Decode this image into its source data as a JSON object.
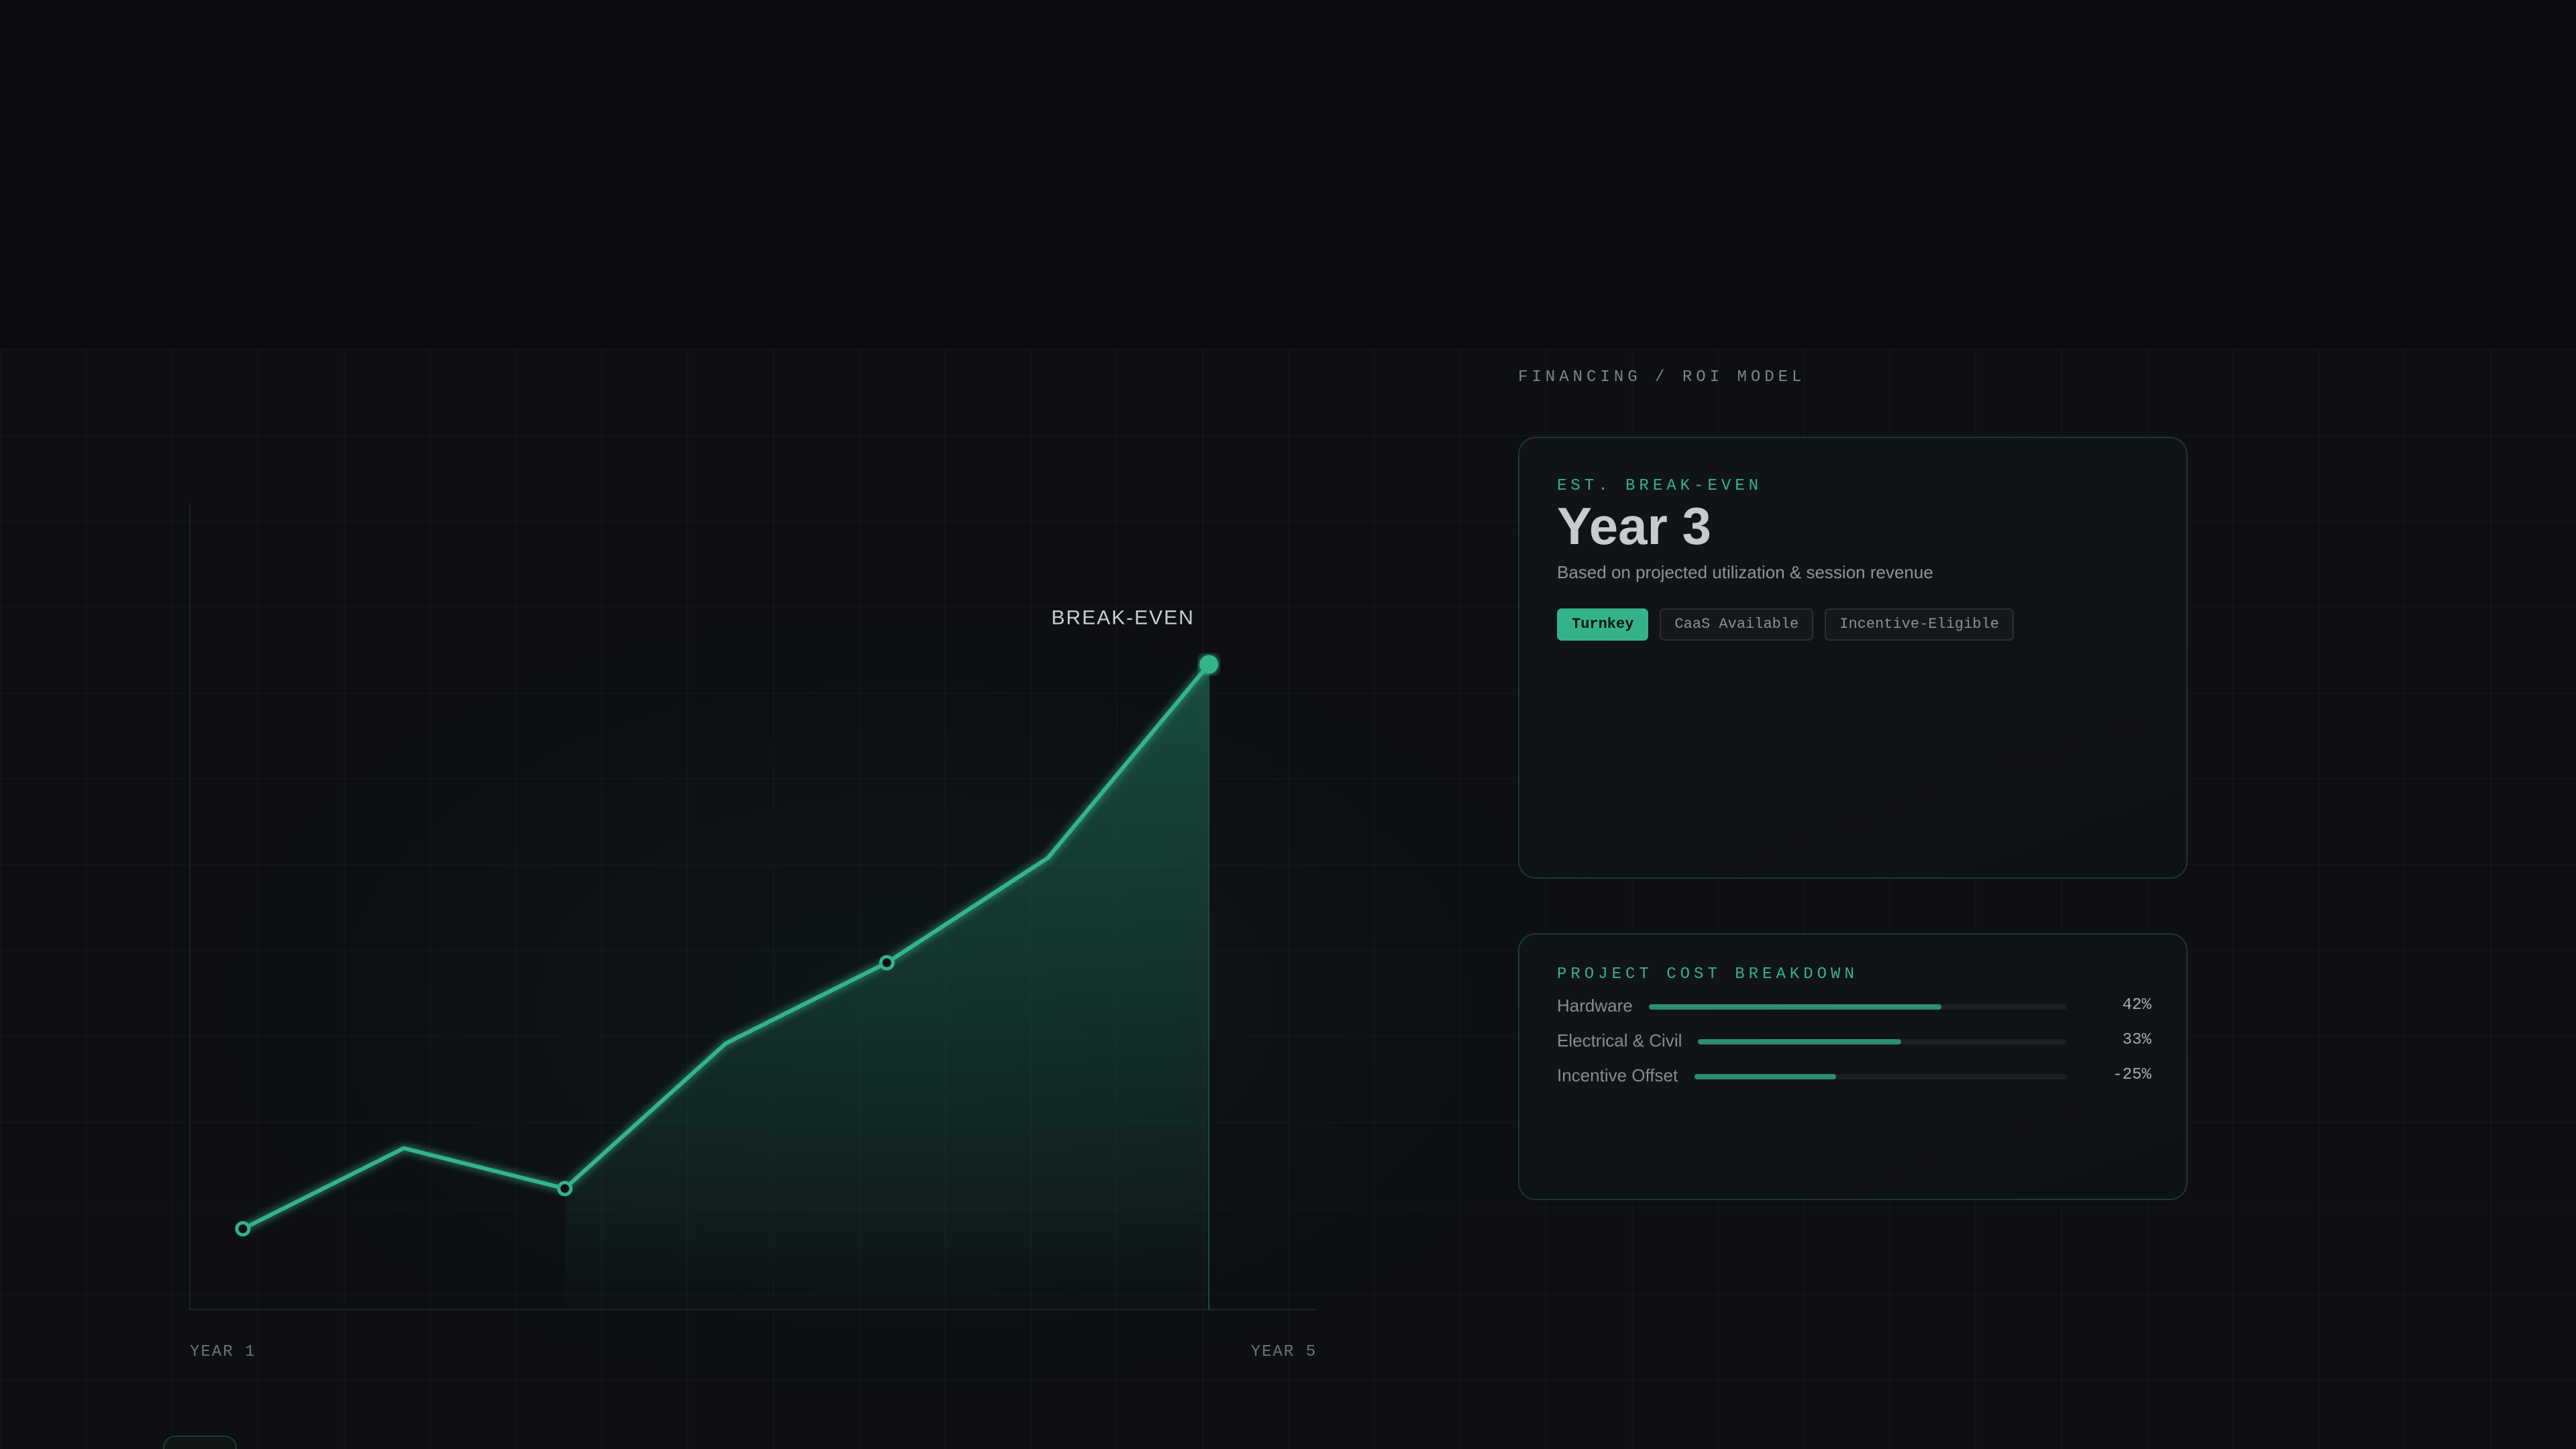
{
  "section": {
    "eyebrow": "FINANCING / ROI MODEL"
  },
  "roi_card": {
    "eyebrow": "EST. BREAK-EVEN",
    "headline": "Year 3",
    "subline": "Based on projected utilization & session revenue",
    "tags": [
      {
        "label": "Turnkey",
        "style": "primary"
      },
      {
        "label": "CaaS Available",
        "style": "secondary"
      },
      {
        "label": "Incentive-Eligible",
        "style": "secondary"
      }
    ]
  },
  "cost_card": {
    "eyebrow": "PROJECT COST BREAKDOWN",
    "rows": [
      {
        "label": "Hardware",
        "value_text": "42%",
        "fill_fraction": 0.7
      },
      {
        "label": "Electrical & Civil",
        "value_text": "33%",
        "fill_fraction": 0.55
      },
      {
        "label": "Incentive Offset",
        "value_text": "-25%",
        "fill_fraction": 0.38
      }
    ]
  },
  "chart_data": {
    "type": "area",
    "title": "",
    "xlabel": "",
    "ylabel": "",
    "x_start_label": "YEAR 1",
    "x_end_label": "YEAR 5",
    "annotation": "BREAK-EVEN",
    "series": [
      {
        "values": [
          0.1,
          0.2,
          0.15,
          0.33,
          0.43,
          0.56,
          0.8
        ],
        "markers": [
          0,
          2,
          4
        ],
        "filled_from_index": 2,
        "highlight_index": 6
      }
    ],
    "ylim": [
      0,
      1
    ],
    "grid": true,
    "colors": {
      "line": "#34b38a",
      "area": "#1e6b56",
      "background": "#0d0f12"
    }
  }
}
